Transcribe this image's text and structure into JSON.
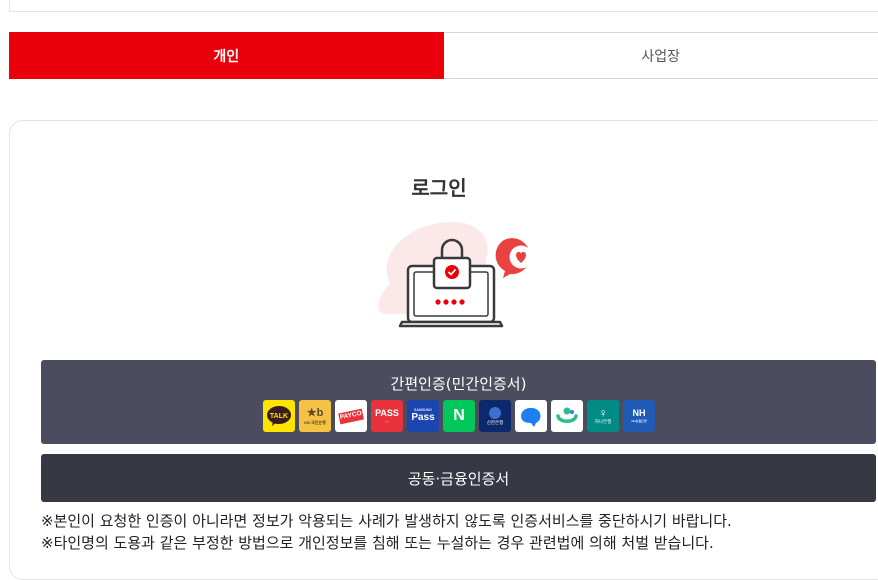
{
  "tabs": [
    {
      "label": "개인",
      "active": true
    },
    {
      "label": "사업장",
      "active": false
    }
  ],
  "login": {
    "title": "로그인",
    "simple_auth_label": "간편인증(민간인증서)",
    "common_auth_label": "공동·금융인증서"
  },
  "providers": [
    {
      "icon": "kakaotalk-icon",
      "text": "TALK"
    },
    {
      "icon": "kb-bank-icon",
      "text": "KB 국민은행"
    },
    {
      "icon": "payco-icon",
      "text": "PAYCO"
    },
    {
      "icon": "pass-icon",
      "text": "PASS"
    },
    {
      "icon": "samsung-pass-icon",
      "text": "Pass"
    },
    {
      "icon": "naver-icon",
      "text": "N"
    },
    {
      "icon": "shinhan-bank-icon",
      "text": "신한은행"
    },
    {
      "icon": "toss-icon",
      "text": ""
    },
    {
      "icon": "bank-salad-icon",
      "text": ""
    },
    {
      "icon": "hana-bank-icon",
      "text": "하나은행"
    },
    {
      "icon": "nh-bank-icon",
      "text": "NH"
    }
  ],
  "notices": [
    "※본인이 요청한 인증이 아니라면 정보가 악용되는 사례가 발생하지 않도록 인증서비스를 중단하시기 바랍니다.",
    "※타인명의 도용과 같은 부정한 방법으로 개인정보를 침해 또는 누설하는 경우 관련법에 의해 처벌 받습니다."
  ],
  "colors": {
    "accent": "#e9000b",
    "simple_button": "#4b4d5e",
    "common_button": "#363843"
  }
}
